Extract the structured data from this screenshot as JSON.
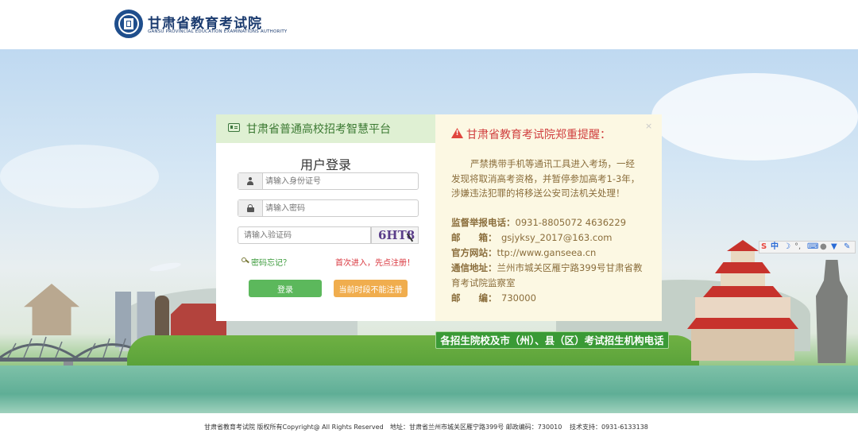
{
  "header": {
    "title": "甘肃省教育考试院",
    "subtitle": "GANSU PROVINCIAL EDUCATION EXAMINATIONS AUTHORITY"
  },
  "login": {
    "platform_title": "甘肃省普通高校招考智慧平台",
    "form_title": "用户登录",
    "id_placeholder": "请输入身份证号",
    "password_placeholder": "请输入密码",
    "captcha_placeholder": "请输入验证码",
    "captcha_text": "6HT8",
    "forgot_password": "密码忘记？",
    "first_register": "首次进入，先点注册！",
    "login_button": "登录",
    "register_button": "当前时段不能注册"
  },
  "notice": {
    "title": "甘肃省教育考试院郑重提醒：",
    "close": "×",
    "body": "严禁携带手机等通讯工具进入考场，一经发现将取消高考资格，并暂停参加高考1-3年，涉嫌违法犯罪的将移送公安司法机关处理！",
    "hotline_label": "监督举报电话：",
    "hotline_value": "0931-8805072 4636229",
    "email_label": "邮　　箱：",
    "email_value": "gsjyksy_2017@163.com",
    "website_label": "官方网站：",
    "website_value": "ttp://www.ganseea.cn",
    "address_label": "通信地址：",
    "address_value": "兰州市城关区雁宁路399号甘肃省教育考试院监察室",
    "postcode_label": "邮　　编：",
    "postcode_value": "730000"
  },
  "contacts_button": "各招生院校及市（州）、县（区）考试招生机构电话",
  "ime": {
    "logo": "S",
    "mode": "中"
  },
  "footer": {
    "copyright": "甘肃省教育考试院 版权所有Copyright@ All Rights Reserved",
    "address": "地址：甘肃省兰州市城关区雁宁路399号 邮政编码：730010",
    "tech": "技术支持：0931-6133138"
  },
  "colors": {
    "brand": "#1b3b6f",
    "green": "#5cb85c",
    "orange": "#f0ad4e",
    "warning_bg": "#fcf8e3",
    "warning_text": "#8a6d3b",
    "alert_red": "#d03f3f"
  }
}
